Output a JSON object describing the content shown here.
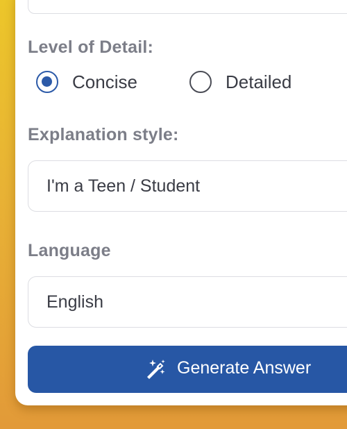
{
  "form": {
    "detail": {
      "label": "Level of Detail:",
      "options": [
        {
          "label": "Concise",
          "selected": true
        },
        {
          "label": "Detailed",
          "selected": false
        }
      ]
    },
    "style": {
      "label": "Explanation style:",
      "value": "I'm a Teen / Student"
    },
    "language": {
      "label": "Language",
      "value": "English"
    },
    "generate": {
      "label": "Generate Answer",
      "icon": "magic-wand-icon"
    }
  },
  "colors": {
    "accent": "#2757a5",
    "background_gradient": [
      "#ecc62a",
      "#e29a38"
    ],
    "label": "#7c7e88",
    "text": "#3a3c45"
  }
}
